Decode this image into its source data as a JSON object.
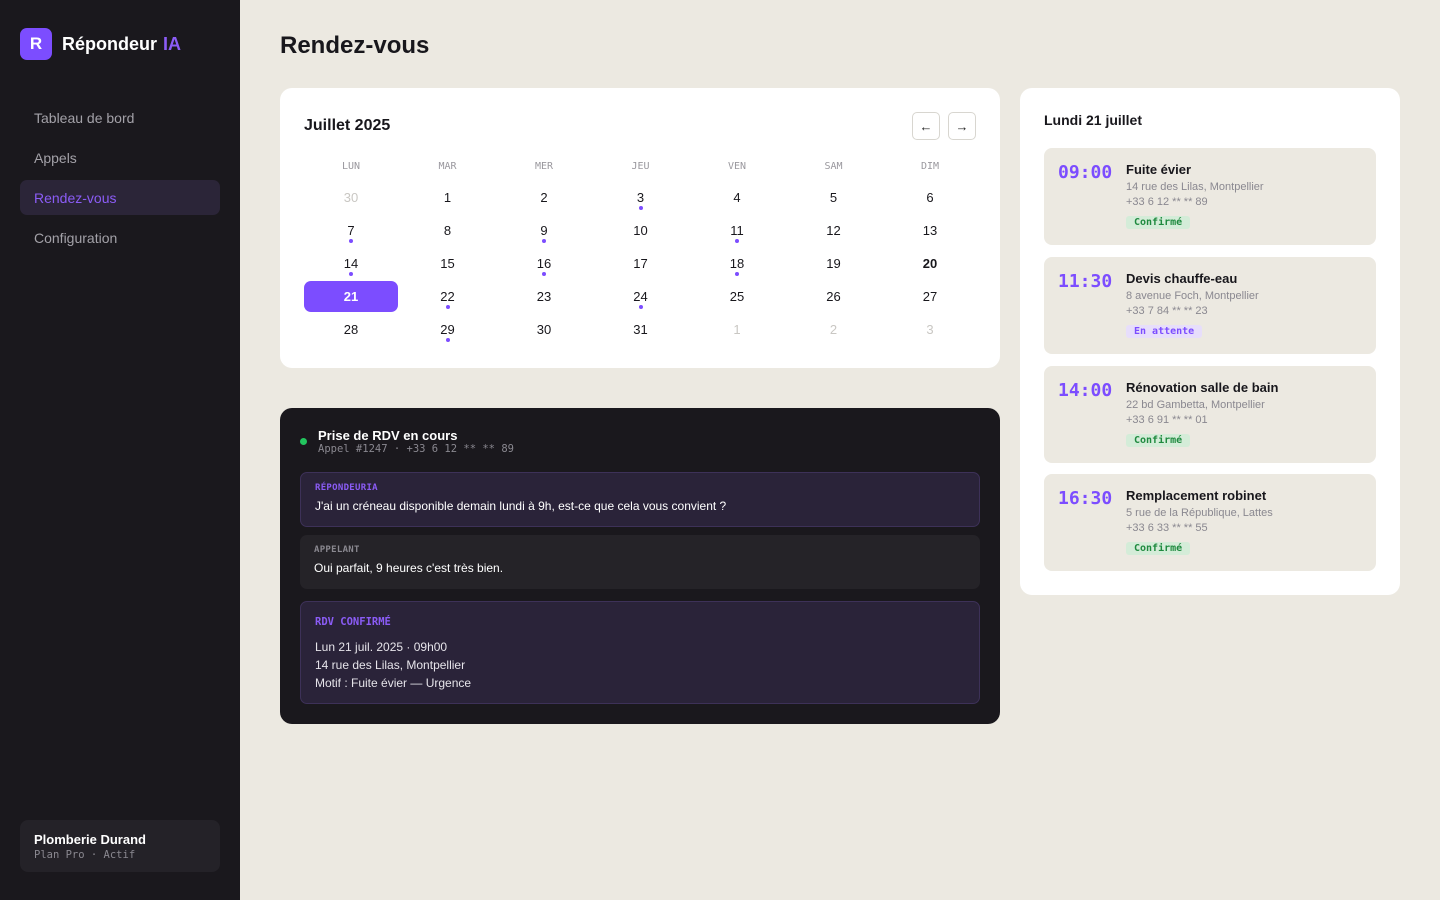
{
  "brand": {
    "logo_letter": "R",
    "name": "Répondeur",
    "accent": "IA"
  },
  "nav": [
    {
      "label": "Tableau de bord",
      "active": false
    },
    {
      "label": "Appels",
      "active": false
    },
    {
      "label": "Rendez-vous",
      "active": true
    },
    {
      "label": "Configuration",
      "active": false
    }
  ],
  "account": {
    "name": "Plomberie Durand",
    "plan": "Plan Pro · Actif"
  },
  "page": {
    "title": "Rendez-vous"
  },
  "calendar": {
    "month": "Juillet 2025",
    "prev_label": "←",
    "next_label": "→",
    "weekdays": [
      "LUN",
      "MAR",
      "MER",
      "JEU",
      "VEN",
      "SAM",
      "DIM"
    ],
    "days": [
      {
        "label": "30",
        "muted": true
      },
      {
        "label": "1"
      },
      {
        "label": "2"
      },
      {
        "label": "3",
        "dot": true
      },
      {
        "label": "4"
      },
      {
        "label": "5"
      },
      {
        "label": "6"
      },
      {
        "label": "7",
        "dot": true
      },
      {
        "label": "8"
      },
      {
        "label": "9",
        "dot": true
      },
      {
        "label": "10"
      },
      {
        "label": "11",
        "dot": true
      },
      {
        "label": "12"
      },
      {
        "label": "13"
      },
      {
        "label": "14",
        "dot": true
      },
      {
        "label": "15"
      },
      {
        "label": "16",
        "dot": true
      },
      {
        "label": "17"
      },
      {
        "label": "18",
        "dot": true
      },
      {
        "label": "19"
      },
      {
        "label": "20",
        "today": true
      },
      {
        "label": "21",
        "selected": true
      },
      {
        "label": "22",
        "dot": true
      },
      {
        "label": "23"
      },
      {
        "label": "24",
        "dot": true
      },
      {
        "label": "25"
      },
      {
        "label": "26"
      },
      {
        "label": "27"
      },
      {
        "label": "28"
      },
      {
        "label": "29",
        "dot": true
      },
      {
        "label": "30"
      },
      {
        "label": "31"
      },
      {
        "label": "1",
        "muted": true
      },
      {
        "label": "2",
        "muted": true
      },
      {
        "label": "3",
        "muted": true
      }
    ]
  },
  "live_call": {
    "title": "Prise de RDV en cours",
    "subtitle": "Appel #1247 · +33 6 12 ** ** 89",
    "ai_label": "RÉPONDEURIA",
    "ai_text": "J'ai un créneau disponible demain lundi à 9h, est-ce que cela vous convient ?",
    "caller_label": "APPELANT",
    "caller_text": "Oui parfait, 9 heures c'est très bien.",
    "confirm_label": "RDV CONFIRMÉ",
    "confirm_lines": [
      "Lun 21 juil. 2025 · 09h00",
      "14 rue des Lilas, Montpellier",
      "Motif : Fuite évier — Urgence"
    ]
  },
  "day_panel": {
    "title": "Lundi 21 juillet",
    "appointments": [
      {
        "time": "09:00",
        "title": "Fuite évier",
        "address": "14 rue des Lilas, Montpellier",
        "phone": "+33 6 12 ** ** 89",
        "status": "Confirmé",
        "status_kind": "ok"
      },
      {
        "time": "11:30",
        "title": "Devis chauffe-eau",
        "address": "8 avenue Foch, Montpellier",
        "phone": "+33 7 84 ** ** 23",
        "status": "En attente",
        "status_kind": "wait"
      },
      {
        "time": "14:00",
        "title": "Rénovation salle de bain",
        "address": "22 bd Gambetta, Montpellier",
        "phone": "+33 6 91 ** ** 01",
        "status": "Confirmé",
        "status_kind": "ok"
      },
      {
        "time": "16:30",
        "title": "Remplacement robinet",
        "address": "5 rue de la République, Lattes",
        "phone": "+33 6 33 ** ** 55",
        "status": "Confirmé",
        "status_kind": "ok"
      }
    ]
  },
  "colors": {
    "accent": "#7c4dff",
    "sidebar_bg": "#1a181d",
    "page_bg": "#ece9e1",
    "live_dot": "#22c55e",
    "confirmed": "#1f8a3f"
  }
}
